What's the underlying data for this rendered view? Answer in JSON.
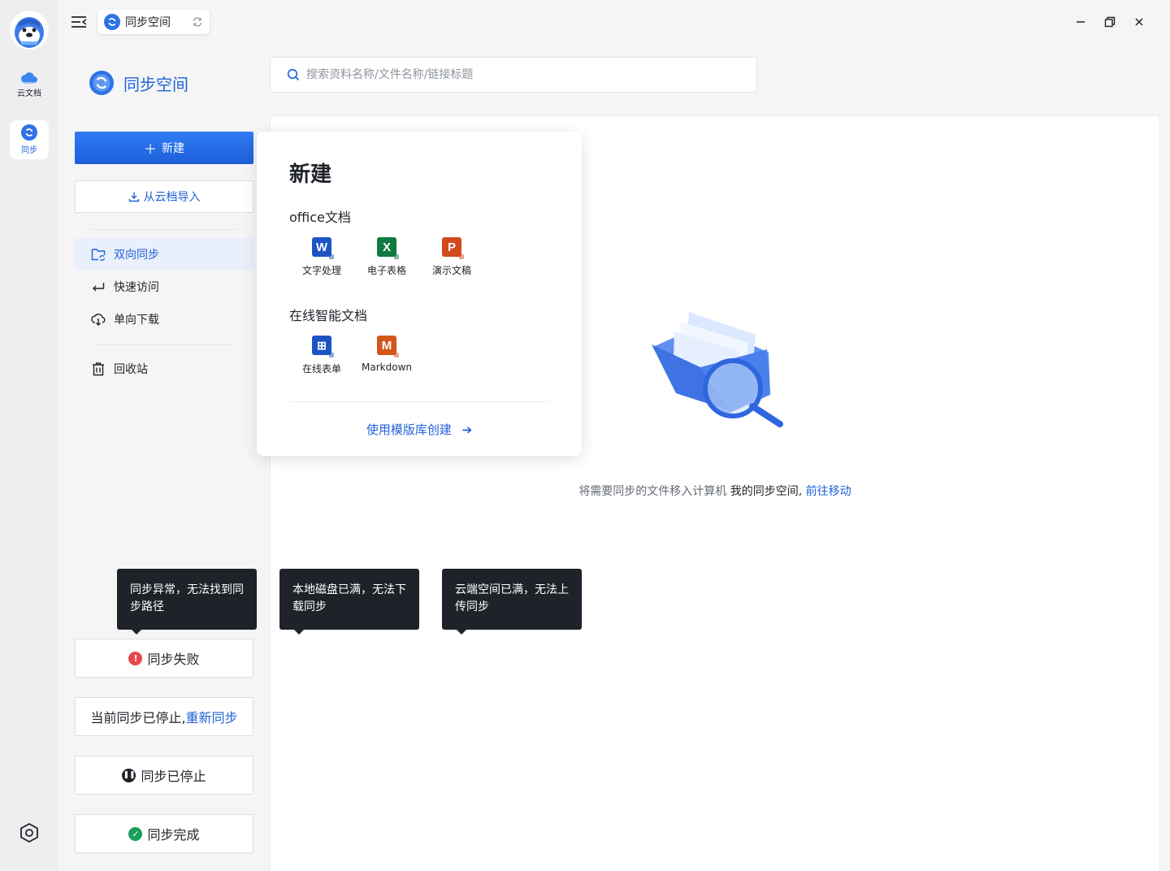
{
  "rail": {
    "items": [
      {
        "label": "云文档",
        "icon": "cloud-icon"
      },
      {
        "label": "同步",
        "icon": "sync-icon"
      }
    ]
  },
  "tab": {
    "title": "同步空间"
  },
  "sidebar": {
    "brand": "同步空间",
    "new_label": "新建",
    "import_label": "从云档导入",
    "nav": [
      {
        "label": "双向同步"
      },
      {
        "label": "快速访问"
      },
      {
        "label": "单向下载"
      },
      {
        "label": "回收站"
      }
    ]
  },
  "search": {
    "placeholder": "搜索资料名称/文件名称/链接标题"
  },
  "popover": {
    "title": "新建",
    "office_title": "office文档",
    "office_items": [
      {
        "label": "文字处理",
        "glyph": "W",
        "color": "#1d54c4"
      },
      {
        "label": "电子表格",
        "glyph": "X",
        "color": "#0f7a42"
      },
      {
        "label": "演示文稿",
        "glyph": "P",
        "color": "#d24a1d"
      }
    ],
    "online_title": "在线智能文档",
    "online_items": [
      {
        "label": "在线表单",
        "glyph": "⊞",
        "color": "#1d54c4"
      },
      {
        "label": "Markdown",
        "glyph": "M",
        "color": "#d2571d"
      }
    ],
    "template_link": "使用模版库创建"
  },
  "empty": {
    "msg_prefix": "将需要同步的文件移入计算机",
    "msg_bold": "我的同步空间,",
    "msg_link": "前往移动"
  },
  "tooltips": [
    "同步异常，无法找到同步路径",
    "本地磁盘已满，无法下载同步",
    "云端空间已满，无法上传同步"
  ],
  "status": {
    "failed": "同步失败",
    "stopped_prefix": "当前同步已停止,",
    "resync_link": "重新同步",
    "paused": "同步已停止",
    "done": "同步完成"
  },
  "colors": {
    "accent": "#2062d8",
    "error": "#e5484d",
    "success": "#1a9e5c"
  }
}
